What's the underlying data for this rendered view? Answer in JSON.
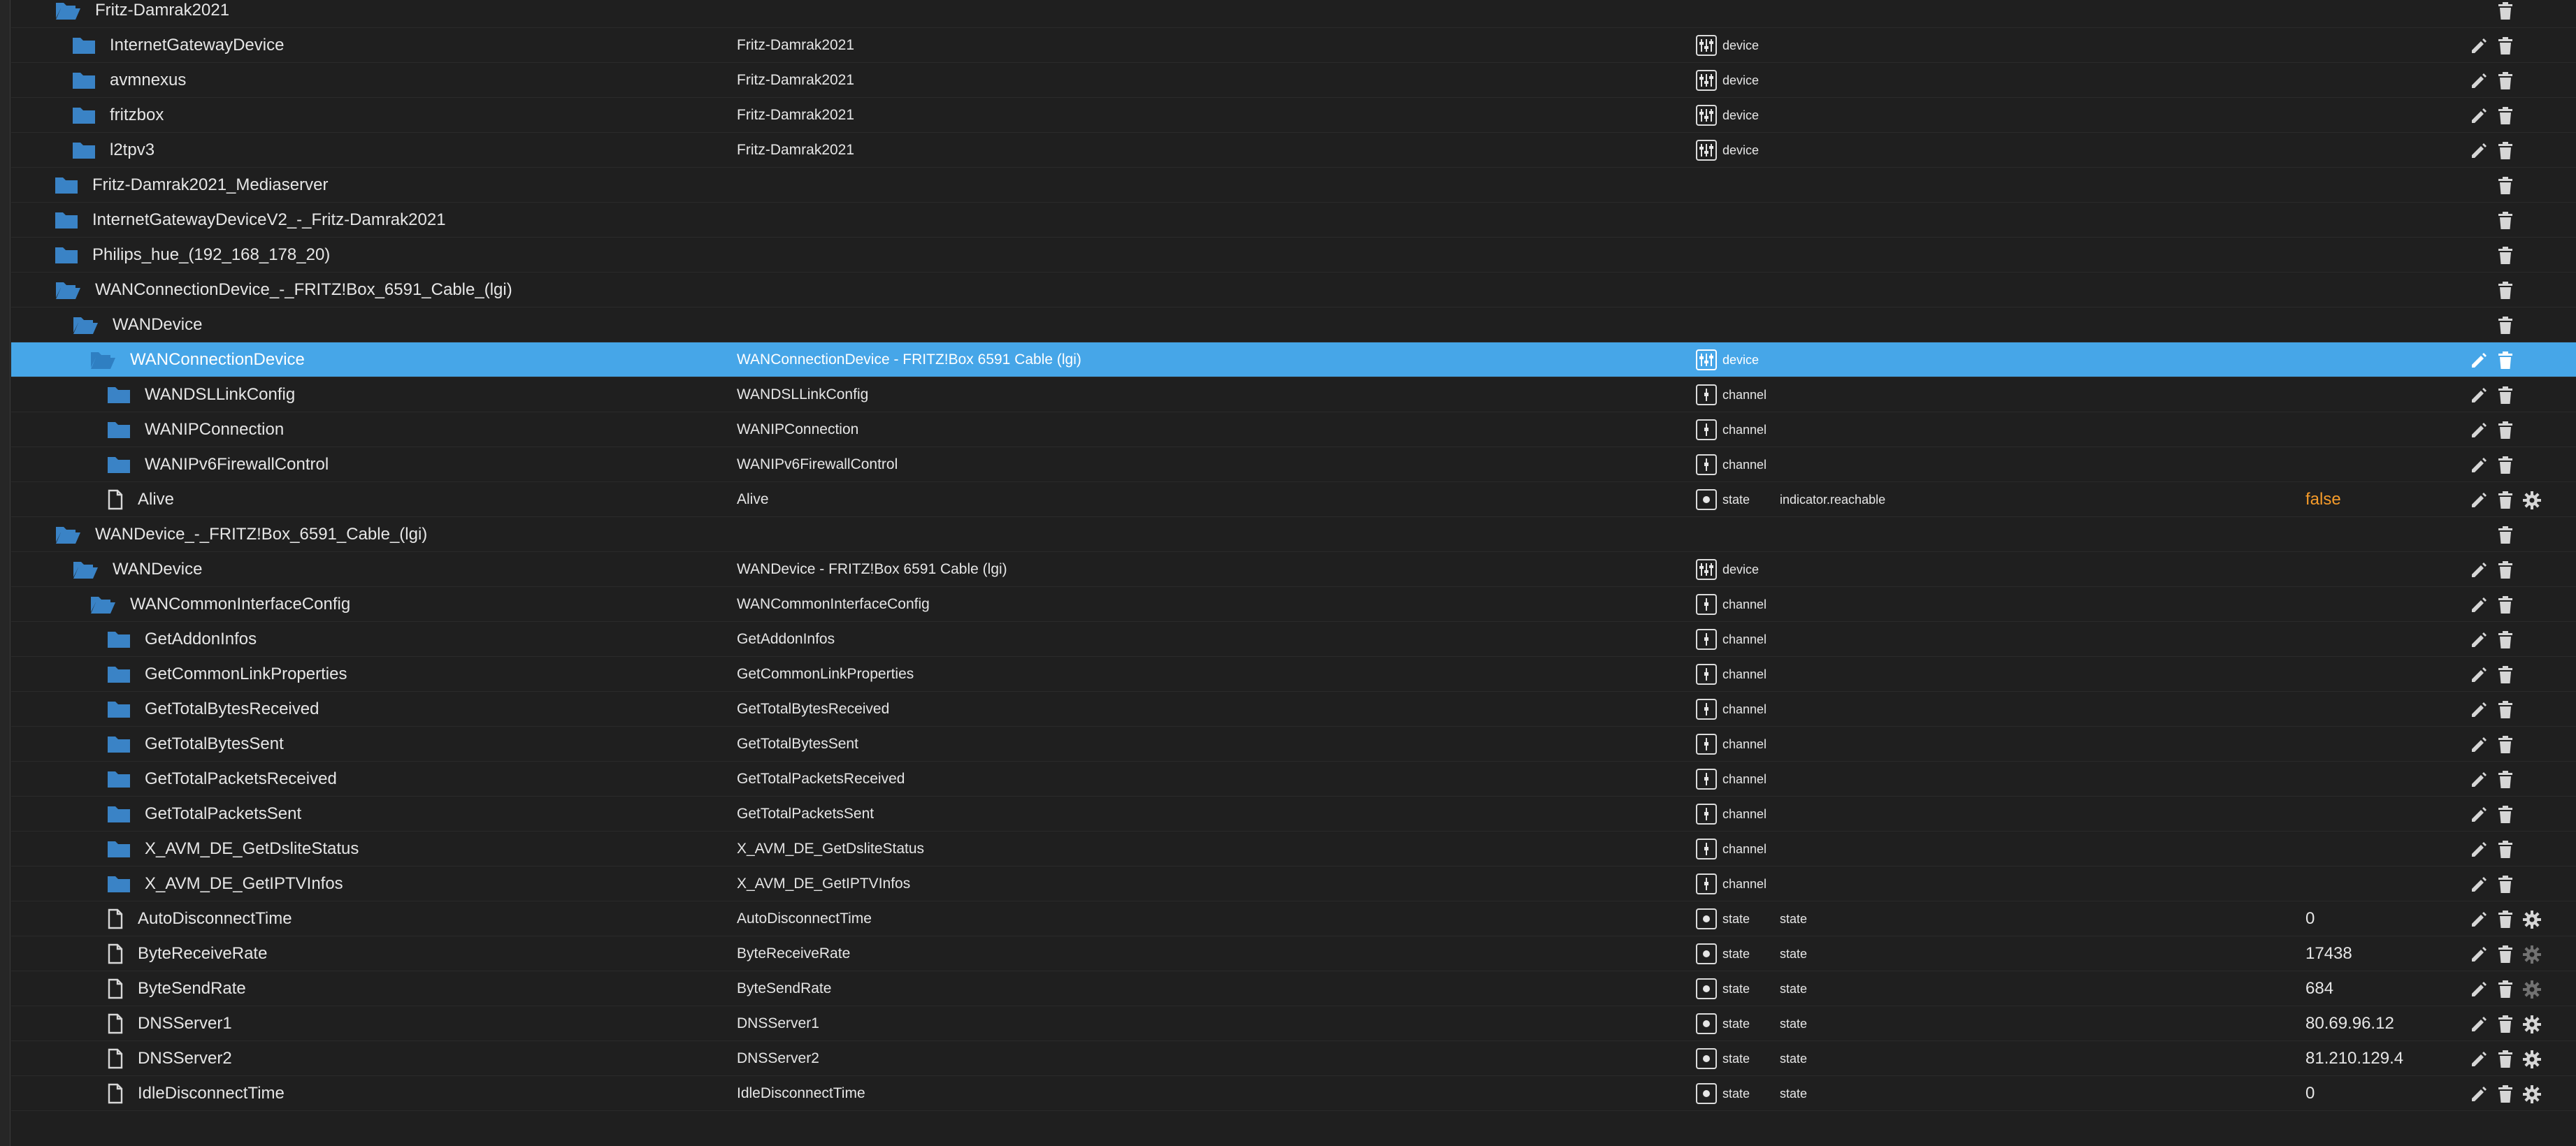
{
  "rows": [
    {
      "id": "Fritz-Damrak2021",
      "level": 0,
      "kind": "folder-open",
      "name": "",
      "type": "",
      "role": "",
      "value": "",
      "edit": false,
      "gear": false
    },
    {
      "id": "InternetGatewayDevice",
      "level": 1,
      "kind": "folder",
      "name": "Fritz-Damrak2021",
      "type": "device",
      "role": "",
      "value": "",
      "edit": true,
      "gear": false
    },
    {
      "id": "avmnexus",
      "level": 1,
      "kind": "folder",
      "name": "Fritz-Damrak2021",
      "type": "device",
      "role": "",
      "value": "",
      "edit": true,
      "gear": false
    },
    {
      "id": "fritzbox",
      "level": 1,
      "kind": "folder",
      "name": "Fritz-Damrak2021",
      "type": "device",
      "role": "",
      "value": "",
      "edit": true,
      "gear": false
    },
    {
      "id": "l2tpv3",
      "level": 1,
      "kind": "folder",
      "name": "Fritz-Damrak2021",
      "type": "device",
      "role": "",
      "value": "",
      "edit": true,
      "gear": false
    },
    {
      "id": "Fritz-Damrak2021_Mediaserver",
      "level": 0,
      "kind": "folder",
      "name": "",
      "type": "",
      "role": "",
      "value": "",
      "edit": false,
      "gear": false
    },
    {
      "id": "InternetGatewayDeviceV2_-_Fritz-Damrak2021",
      "level": 0,
      "kind": "folder",
      "name": "",
      "type": "",
      "role": "",
      "value": "",
      "edit": false,
      "gear": false
    },
    {
      "id": "Philips_hue_(192_168_178_20)",
      "level": 0,
      "kind": "folder",
      "name": "",
      "type": "",
      "role": "",
      "value": "",
      "edit": false,
      "gear": false
    },
    {
      "id": "WANConnectionDevice_-_FRITZ!Box_6591_Cable_(lgi)",
      "level": 0,
      "kind": "folder-open",
      "name": "",
      "type": "",
      "role": "",
      "value": "",
      "edit": false,
      "gear": false
    },
    {
      "id": "WANDevice",
      "level": 1,
      "kind": "folder-open",
      "name": "",
      "type": "",
      "role": "",
      "value": "",
      "edit": false,
      "gear": false
    },
    {
      "id": "WANConnectionDevice",
      "level": 2,
      "kind": "folder-open",
      "name": "WANConnectionDevice - FRITZ!Box 6591 Cable (lgi)",
      "type": "device",
      "role": "",
      "value": "",
      "edit": true,
      "gear": false,
      "selected": true
    },
    {
      "id": "WANDSLLinkConfig",
      "level": 3,
      "kind": "folder",
      "name": "WANDSLLinkConfig",
      "type": "channel",
      "role": "",
      "value": "",
      "edit": true,
      "gear": false
    },
    {
      "id": "WANIPConnection",
      "level": 3,
      "kind": "folder",
      "name": "WANIPConnection",
      "type": "channel",
      "role": "",
      "value": "",
      "edit": true,
      "gear": false
    },
    {
      "id": "WANIPv6FirewallControl",
      "level": 3,
      "kind": "folder",
      "name": "WANIPv6FirewallControl",
      "type": "channel",
      "role": "",
      "value": "",
      "edit": true,
      "gear": false
    },
    {
      "id": "Alive",
      "level": 3,
      "kind": "file",
      "name": "Alive",
      "type": "state",
      "role": "indicator.reachable",
      "value": "false",
      "valueColor": "#f59b2a",
      "edit": true,
      "gear": true
    },
    {
      "id": "WANDevice_-_FRITZ!Box_6591_Cable_(lgi)",
      "level": 0,
      "kind": "folder-open",
      "name": "",
      "type": "",
      "role": "",
      "value": "",
      "edit": false,
      "gear": false
    },
    {
      "id": "WANDevice",
      "level": 1,
      "kind": "folder-open",
      "name": "WANDevice - FRITZ!Box 6591 Cable (lgi)",
      "type": "device",
      "role": "",
      "value": "",
      "edit": true,
      "gear": false
    },
    {
      "id": "WANCommonInterfaceConfig",
      "level": 2,
      "kind": "folder-open",
      "name": "WANCommonInterfaceConfig",
      "type": "channel",
      "role": "",
      "value": "",
      "edit": true,
      "gear": false
    },
    {
      "id": "GetAddonInfos",
      "level": 3,
      "kind": "folder",
      "name": "GetAddonInfos",
      "type": "channel",
      "role": "",
      "value": "",
      "edit": true,
      "gear": false
    },
    {
      "id": "GetCommonLinkProperties",
      "level": 3,
      "kind": "folder",
      "name": "GetCommonLinkProperties",
      "type": "channel",
      "role": "",
      "value": "",
      "edit": true,
      "gear": false
    },
    {
      "id": "GetTotalBytesReceived",
      "level": 3,
      "kind": "folder",
      "name": "GetTotalBytesReceived",
      "type": "channel",
      "role": "",
      "value": "",
      "edit": true,
      "gear": false
    },
    {
      "id": "GetTotalBytesSent",
      "level": 3,
      "kind": "folder",
      "name": "GetTotalBytesSent",
      "type": "channel",
      "role": "",
      "value": "",
      "edit": true,
      "gear": false
    },
    {
      "id": "GetTotalPacketsReceived",
      "level": 3,
      "kind": "folder",
      "name": "GetTotalPacketsReceived",
      "type": "channel",
      "role": "",
      "value": "",
      "edit": true,
      "gear": false
    },
    {
      "id": "GetTotalPacketsSent",
      "level": 3,
      "kind": "folder",
      "name": "GetTotalPacketsSent",
      "type": "channel",
      "role": "",
      "value": "",
      "edit": true,
      "gear": false
    },
    {
      "id": "X_AVM_DE_GetDsliteStatus",
      "level": 3,
      "kind": "folder",
      "name": "X_AVM_DE_GetDsliteStatus",
      "type": "channel",
      "role": "",
      "value": "",
      "edit": true,
      "gear": false
    },
    {
      "id": "X_AVM_DE_GetIPTVInfos",
      "level": 3,
      "kind": "folder",
      "name": "X_AVM_DE_GetIPTVInfos",
      "type": "channel",
      "role": "",
      "value": "",
      "edit": true,
      "gear": false
    },
    {
      "id": "AutoDisconnectTime",
      "level": 3,
      "kind": "file",
      "name": "AutoDisconnectTime",
      "type": "state",
      "role": "state",
      "value": "0",
      "edit": true,
      "gear": true
    },
    {
      "id": "ByteReceiveRate",
      "level": 3,
      "kind": "file",
      "name": "ByteReceiveRate",
      "type": "state",
      "role": "state",
      "value": "17438",
      "edit": true,
      "gear": true,
      "gearDim": true
    },
    {
      "id": "ByteSendRate",
      "level": 3,
      "kind": "file",
      "name": "ByteSendRate",
      "type": "state",
      "role": "state",
      "value": "684",
      "edit": true,
      "gear": true,
      "gearDim": true
    },
    {
      "id": "DNSServer1",
      "level": 3,
      "kind": "file",
      "name": "DNSServer1",
      "type": "state",
      "role": "state",
      "value": "80.69.96.12",
      "edit": true,
      "gear": true
    },
    {
      "id": "DNSServer2",
      "level": 3,
      "kind": "file",
      "name": "DNSServer2",
      "type": "state",
      "role": "state",
      "value": "81.210.129.4",
      "edit": true,
      "gear": true
    },
    {
      "id": "IdleDisconnectTime",
      "level": 3,
      "kind": "file",
      "name": "IdleDisconnectTime",
      "type": "state",
      "role": "state",
      "value": "0",
      "edit": true,
      "gear": true
    }
  ]
}
